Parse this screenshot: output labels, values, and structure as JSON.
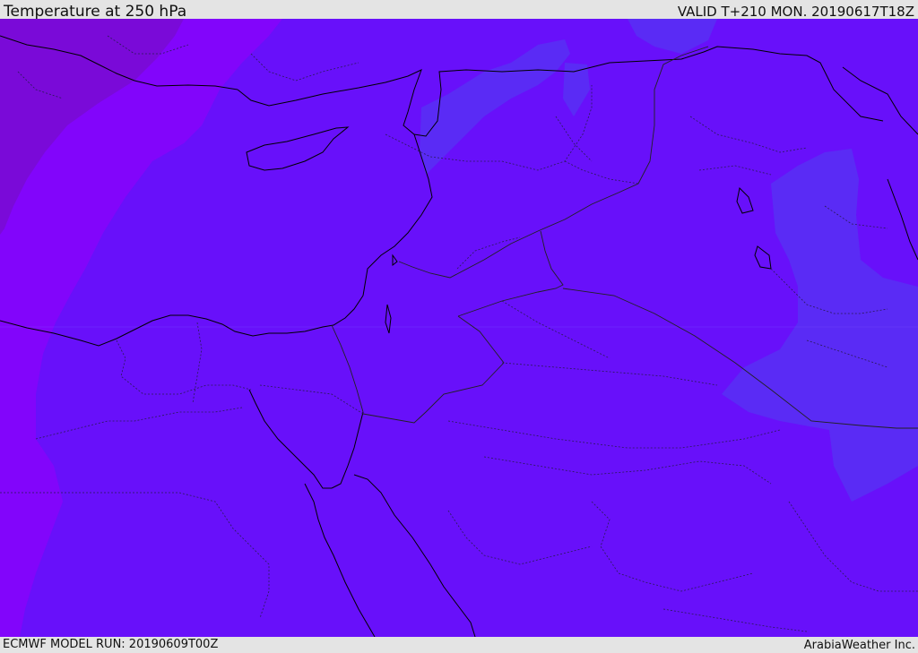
{
  "header": {
    "title": "Temperature at 250 hPa",
    "valid": "VALID T+210 MON. 20190617T18Z"
  },
  "footer": {
    "model_run": "ECMWF MODEL RUN: 20190609T00Z",
    "credit": "ArabiaWeather Inc."
  },
  "map": {
    "region": "Eastern Mediterranean, Levant, Egypt, Arabian Peninsula north, Iraq, Iran west",
    "colors": {
      "base_fill": "#6810fa",
      "warm_band": "#8205fb",
      "warmest_band": "#7a0ad8",
      "cool_patch": "#5a2bf5",
      "coastline": "#000000",
      "border": "#222222"
    }
  }
}
